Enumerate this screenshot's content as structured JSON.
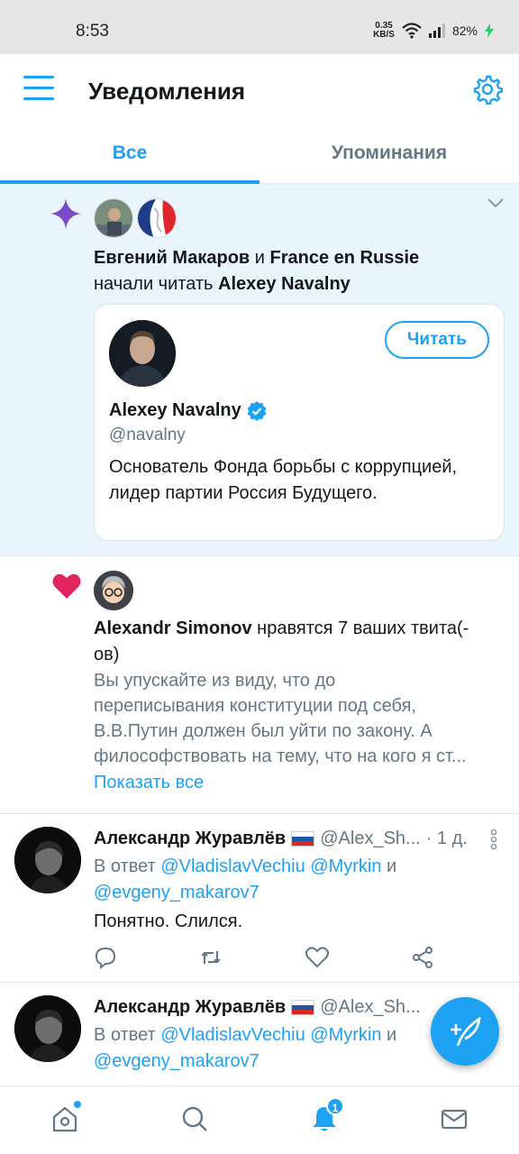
{
  "status_bar": {
    "time": "8:53",
    "net_speed_value": "0.35",
    "net_speed_unit": "KB/S",
    "battery": "82%"
  },
  "header": {
    "title": "Уведомления",
    "menu_icon": "hamburger-icon",
    "settings_icon": "gear-icon"
  },
  "tabs": [
    {
      "label": "Все",
      "active": true
    },
    {
      "label": "Упоминания",
      "active": false
    }
  ],
  "follow_notification": {
    "name1": "Евгений Макаров",
    "conj": " и ",
    "name2": "France en Russie",
    "action_text": "начали читать ",
    "target": "Alexey Navalny",
    "card": {
      "name": "Alexey Navalny",
      "handle": "@navalny",
      "bio": "Основатель Фонда борьбы с коррупцией, лидер партии Россия Будущего.",
      "follow_label": "Читать"
    }
  },
  "like_notification": {
    "name": "Alexandr Simonov",
    "action_text": " нравятся 7 ваших твита(-ов)",
    "tweet_lines": [
      "Вы упускайте из виду, что до",
      "переписывания конституции под себя,",
      "В.В.Путин должен был уйти по закону. А",
      "философствовать на тему, что на кого я ст..."
    ],
    "show_all": "Показать все"
  },
  "tweets": [
    {
      "author": "Александр Журавлёв",
      "handle": "@Alex_Sh...",
      "time": "· 1 д.",
      "reply_prefix": "В ответ ",
      "mention1": "@VladislavVechiu",
      "mention2": "@Myrkin",
      "conj": " и ",
      "mention3": "@evgeny_makarov7",
      "text": "Понятно. Слился."
    },
    {
      "author": "Александр Журавлёв",
      "handle": "@Alex_Sh...",
      "reply_prefix": "В ответ ",
      "mention1": "@VladislavVechiu",
      "mention2": "@Myrkin",
      "conj": " и ",
      "mention3": "@evgeny_makarov7"
    }
  ],
  "bottom_nav": {
    "notification_badge": "1"
  },
  "colors": {
    "accent": "#1da1f2",
    "highlight_bg": "#e8f5fd",
    "like": "#e0245e",
    "sparkle": "#794bc4",
    "secondary_text": "#657786"
  }
}
